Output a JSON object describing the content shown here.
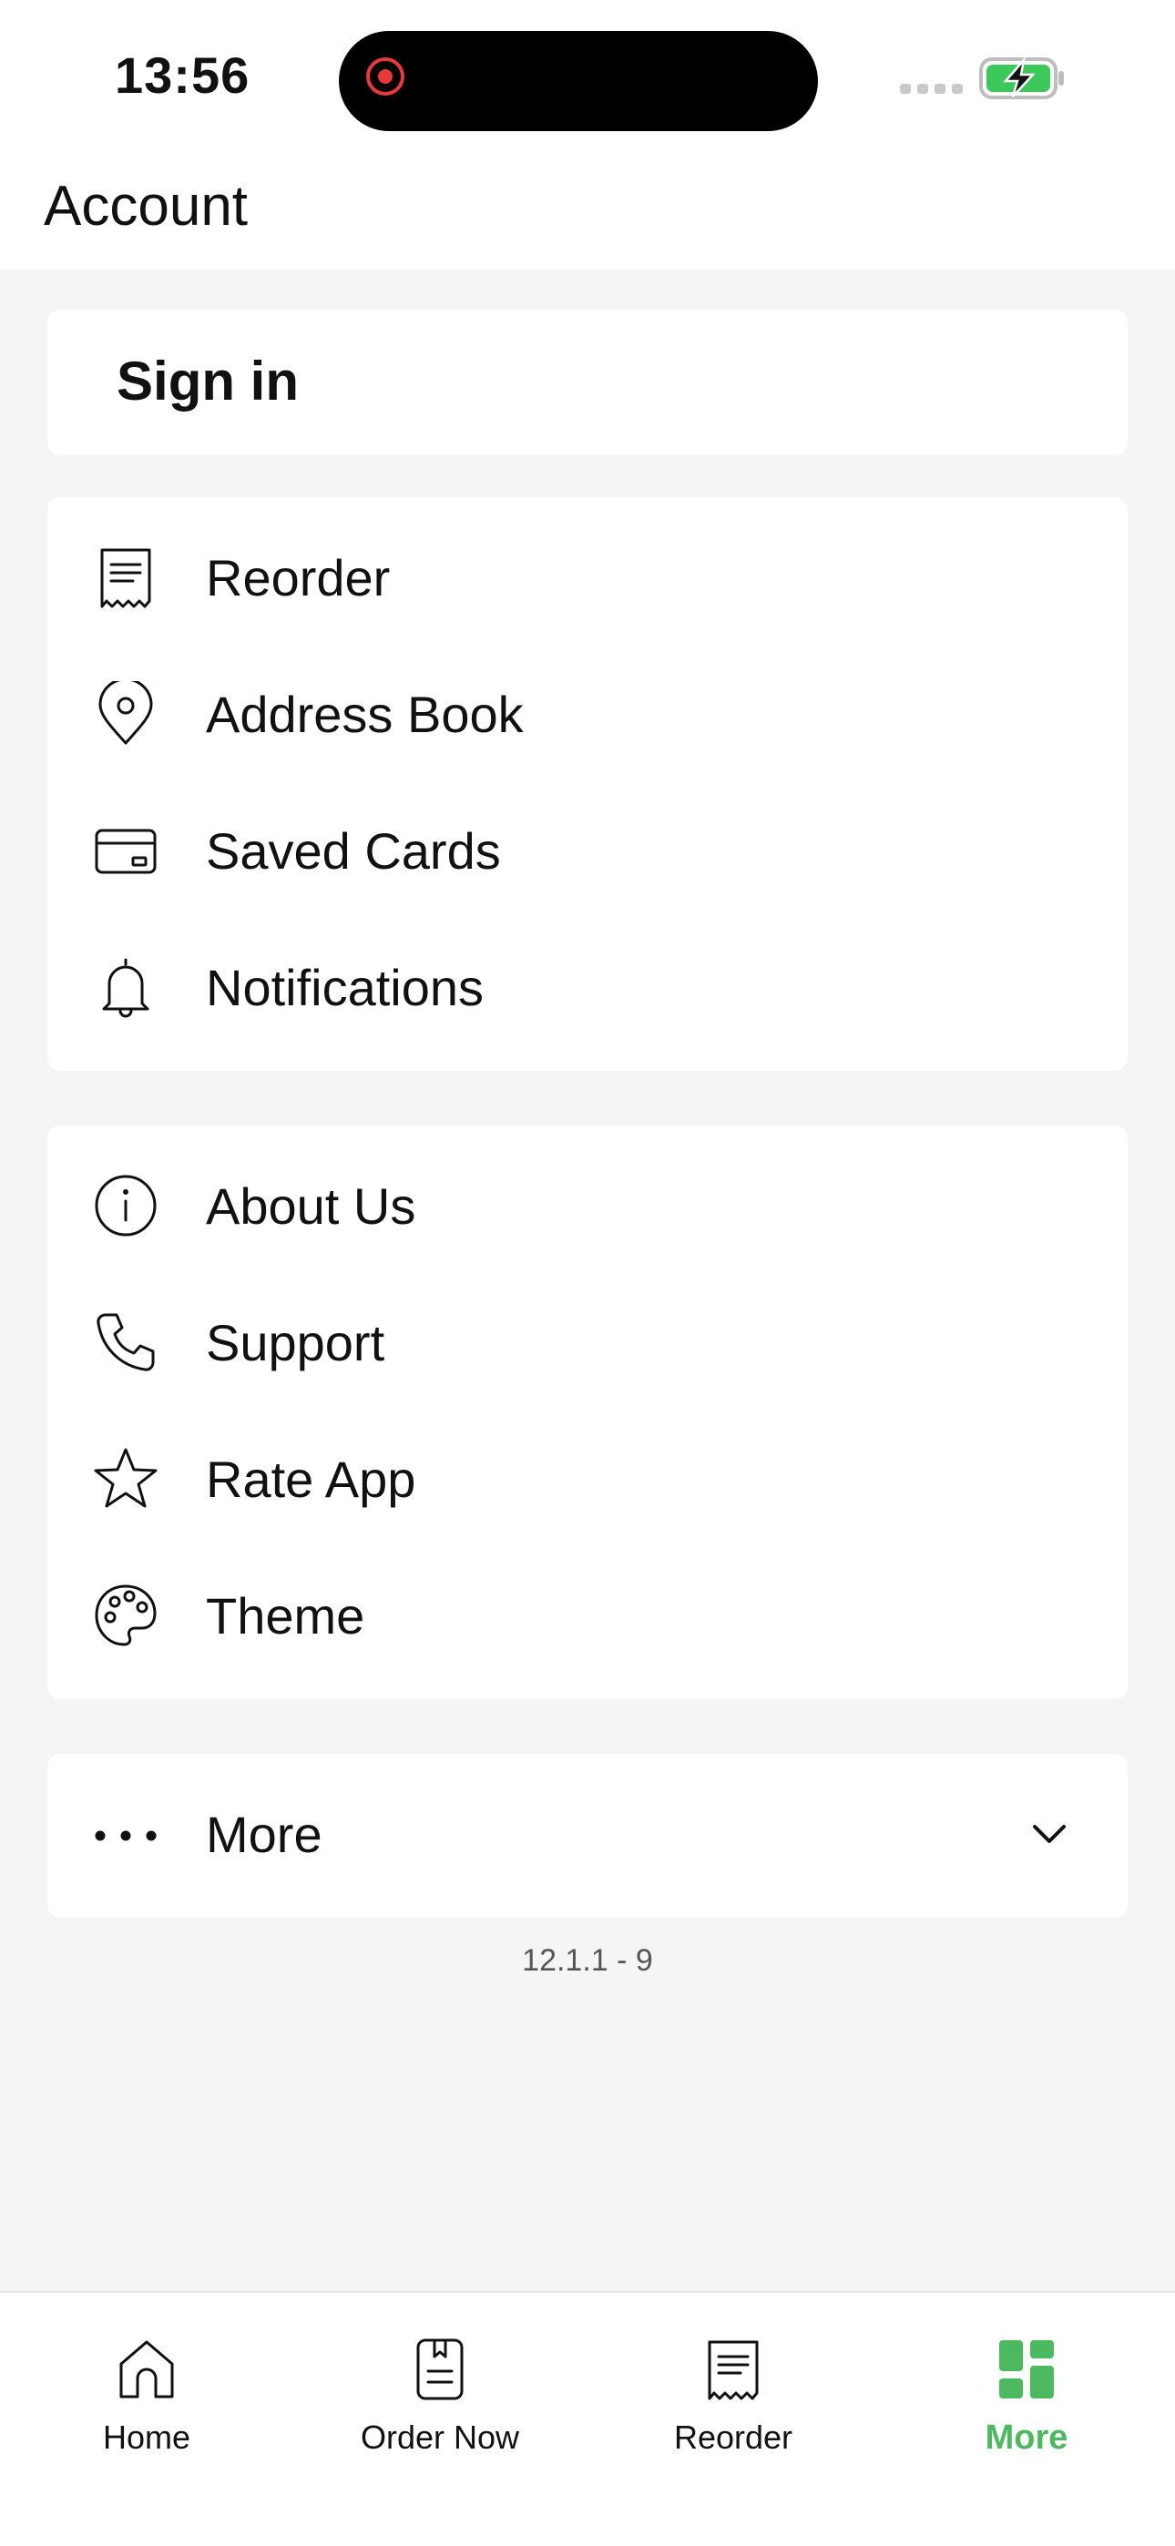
{
  "status_bar": {
    "time": "13:56"
  },
  "header": {
    "title": "Account"
  },
  "signin": {
    "label": "Sign in"
  },
  "group1": {
    "items": [
      {
        "label": "Reorder",
        "icon": "receipt-icon"
      },
      {
        "label": "Address Book",
        "icon": "location-pin-icon"
      },
      {
        "label": "Saved Cards",
        "icon": "credit-card-icon"
      },
      {
        "label": "Notifications",
        "icon": "bell-icon"
      }
    ]
  },
  "group2": {
    "items": [
      {
        "label": "About Us",
        "icon": "info-icon"
      },
      {
        "label": "Support",
        "icon": "phone-icon"
      },
      {
        "label": "Rate App",
        "icon": "star-icon"
      },
      {
        "label": "Theme",
        "icon": "palette-icon"
      }
    ]
  },
  "more": {
    "label": "More",
    "icon": "ellipsis-icon",
    "expanded": false
  },
  "version": "12.1.1 - 9",
  "tabbar": {
    "tabs": [
      {
        "label": "Home",
        "icon": "home-icon",
        "active": false
      },
      {
        "label": "Order Now",
        "icon": "menu-book-icon",
        "active": false
      },
      {
        "label": "Reorder",
        "icon": "receipt-icon",
        "active": false
      },
      {
        "label": "More",
        "icon": "grid-icon",
        "active": true
      }
    ]
  },
  "colors": {
    "accent": "#4cb860",
    "background": "#f5f5f5",
    "card": "#ffffff",
    "record": "#e63a3a"
  }
}
